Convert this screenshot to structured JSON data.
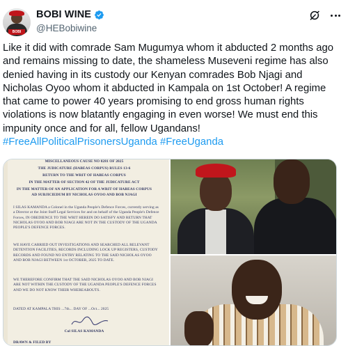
{
  "author": {
    "display_name": "BOBI WINE",
    "handle": "@HEBobiwine",
    "avatar_badge": "BOBI"
  },
  "actions": {
    "grok_icon": "grok-icon",
    "more_icon": "more-options-icon"
  },
  "tweet": {
    "lines": [
      "Like it did with comrade Sam Mugumya whom it abducted 2 months ago",
      "and remains missing to date, the shameless Museveni regime has also",
      "denied having in its custody our Kenyan comrades Bob Njagi and",
      "Nicholas Oyoo whom it abducted in Kampala on 1st October! A regime",
      "that came to power 40 years promising to end gross human rights",
      "violations is now blatantly engaging in even worse! We must end this",
      "impunity once and for all, fellow Ugandans!"
    ],
    "hashtags": [
      "#FreeAllPoliticalPrisonersUganda",
      "#FreeUganda"
    ]
  },
  "colors": {
    "link": "#1d9bf0",
    "verified": "#1d9bf0",
    "ink": "#2f3560"
  },
  "document": {
    "heading_1": "MISCELLANEOUS CAUSE NO 0281 OF 2025",
    "heading_2": "THE JUDICATURE (HABEAS CORPUS) RULES 13-6",
    "heading_3": "RETURN TO THE WRIT OF HABEAS CORPUS",
    "heading_4": "IN THE MATTER OF SECTION 42 OF THE JUDICATURE ACT",
    "heading_5": "IN THE MATTER OF AN APPLICATION FOR A WRIT OF HABEAS CORPUS",
    "heading_6": "AD SUBJICIEDUM BY NICHOLAS OYOO AND BOB NJAGI",
    "para_1": "I SILAS KAMANDA a Colonel in the Uganda People's Defence Forces, currently serving as a Director at the Joint Staff Legal Services for and on behalf of the Uganda People's Defence Forces, IN OBEDIENCE TO THE WRIT HEREIN DO SATISFY AND RETURN THAT NICHOLAS OYOO AND BOB NJAGI ARE NOT IN THE CUSTODY OF THE UGANDA PEOPLE'S DEFENCE FORCES.",
    "para_2": "WE HAVE CARRIED OUT INVESTIGATIONS AND SEARCHED ALL RELEVANT DETENTION FACILITIES, RECORDS INCLUDING LOCK UP REGISTERS, CUSTODY RECORDS AND FOUND NO ENTRY RELATING TO THE SAID NICHOLAS OYOO AND BOB NJAGI BETWEEN 1st OCTOBER, 2025 TO DATE.",
    "para_3": "WE THEREFORE CONFIRM THAT THE SAID NICHOLAS OYOO AND BOB NJAGI ARE NOT WITHIN THE CUSTODY OF THE UGANDA PEOPLE'S DEFENCE FORCES AND WE DO NOT KNOW THEIR WHEREABOUTS.",
    "dated": "DATED AT KAMPALA THIS ...7th... DAY OF ...Oct... 2025",
    "signatory": "Col SILAS KAMANDA",
    "drawn_by": "DRAWN & FILED BY"
  }
}
